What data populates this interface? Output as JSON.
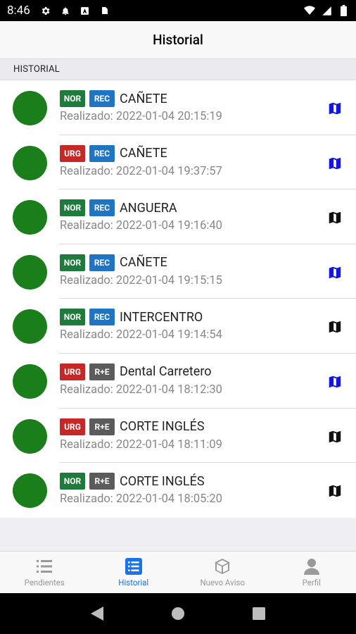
{
  "status_bar": {
    "time": "8:46"
  },
  "header": {
    "title": "Historial"
  },
  "section": {
    "label": "HISTORIAL"
  },
  "colors": {
    "NOR": "#1e7b3c",
    "URG": "#c62828",
    "REC": "#1f74c4",
    "R+E": "#5b5b5b",
    "status_dot": "#1a7f1a",
    "map_blue": "#1515e0",
    "map_black": "#111111"
  },
  "items": [
    {
      "priority": "NOR",
      "type": "REC",
      "title": "CAÑETE",
      "subtitle": "Realizado: 2022-01-04 20:15:19",
      "map_icon_color": "blue"
    },
    {
      "priority": "URG",
      "type": "REC",
      "title": "CAÑETE",
      "subtitle": "Realizado: 2022-01-04 19:37:57",
      "map_icon_color": "blue"
    },
    {
      "priority": "NOR",
      "type": "REC",
      "title": "ANGUERA",
      "subtitle": "Realizado: 2022-01-04 19:16:40",
      "map_icon_color": "black"
    },
    {
      "priority": "NOR",
      "type": "REC",
      "title": "CAÑETE",
      "subtitle": "Realizado: 2022-01-04 19:15:15",
      "map_icon_color": "blue"
    },
    {
      "priority": "NOR",
      "type": "REC",
      "title": "INTERCENTRO",
      "subtitle": "Realizado: 2022-01-04 19:14:54",
      "map_icon_color": "black"
    },
    {
      "priority": "URG",
      "type": "R+E",
      "title": "Dental Carretero",
      "subtitle": "Realizado: 2022-01-04 18:12:30",
      "map_icon_color": "blue"
    },
    {
      "priority": "URG",
      "type": "R+E",
      "title": "CORTE INGLÉS",
      "subtitle": "Realizado: 2022-01-04 18:11:09",
      "map_icon_color": "black"
    },
    {
      "priority": "NOR",
      "type": "R+E",
      "title": "CORTE INGLÉS",
      "subtitle": "Realizado: 2022-01-04 18:05:20",
      "map_icon_color": "black"
    }
  ],
  "tabs": [
    {
      "label": "Pendientes",
      "icon": "list-icon",
      "active": false
    },
    {
      "label": "Historial",
      "icon": "list-box-icon",
      "active": true
    },
    {
      "label": "Nuevo Aviso",
      "icon": "cube-icon",
      "active": false
    },
    {
      "label": "Perfil",
      "icon": "person-icon",
      "active": false
    }
  ]
}
